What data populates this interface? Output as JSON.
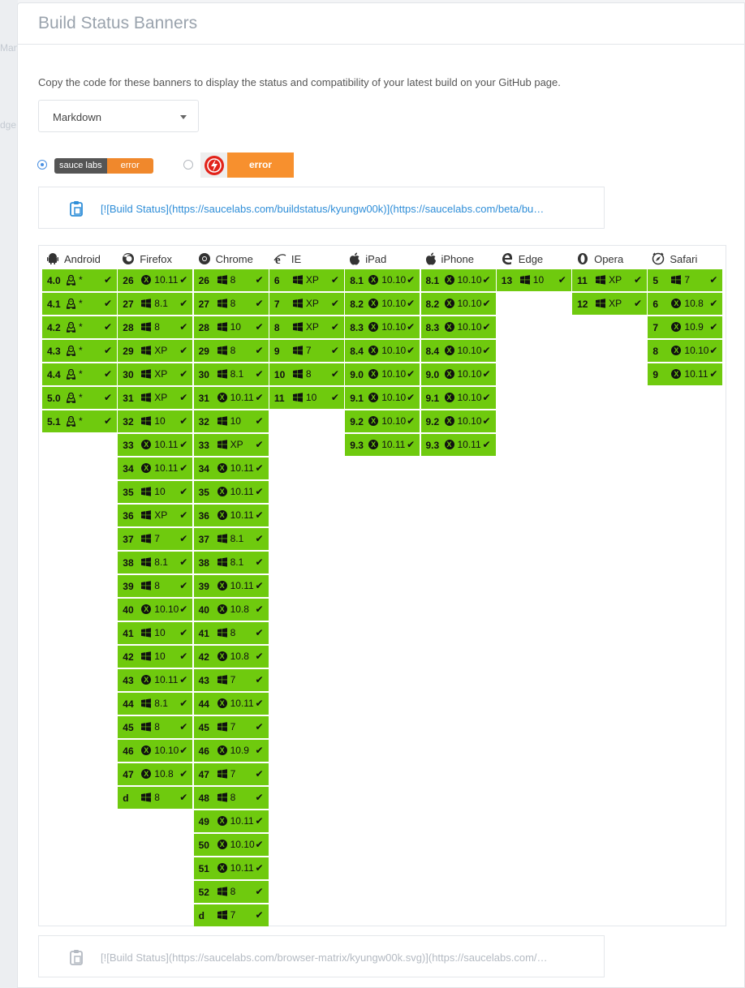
{
  "background": {
    "ghost_1": "Man",
    "ghost_2": "dge"
  },
  "title": "Build Status Banners",
  "description": "Copy the code for these banners to display the status and compatibility of your latest build on your GitHub page.",
  "format_select": {
    "value": "Markdown"
  },
  "badge_small": {
    "left": "sauce labs",
    "right": "error",
    "selected": true
  },
  "badge_large": {
    "right": "error",
    "selected": false
  },
  "code_1": "[![Build Status](https://saucelabs.com/buildstatus/kyungw00k)](https://saucelabs.com/beta/bu…",
  "code_2": "[![Build Status](https://saucelabs.com/browser-matrix/kyungw00k.svg)](https://saucelabs.com/…",
  "colors": {
    "pass": "#6fca0e",
    "badge_error": "#f0882c",
    "link": "#2f8ed8"
  },
  "matrix": {
    "columns": [
      {
        "name": "Android",
        "icon": "android-icon",
        "cells": [
          {
            "v": "4.0",
            "os": "linux",
            "osv": "*"
          },
          {
            "v": "4.1",
            "os": "linux",
            "osv": "*"
          },
          {
            "v": "4.2",
            "os": "linux",
            "osv": "*"
          },
          {
            "v": "4.3",
            "os": "linux",
            "osv": "*"
          },
          {
            "v": "4.4",
            "os": "linux",
            "osv": "*"
          },
          {
            "v": "5.0",
            "os": "linux",
            "osv": "*"
          },
          {
            "v": "5.1",
            "os": "linux",
            "osv": "*"
          }
        ]
      },
      {
        "name": "Firefox",
        "icon": "firefox-icon",
        "cells": [
          {
            "v": "26",
            "os": "mac",
            "osv": "10.11"
          },
          {
            "v": "27",
            "os": "win",
            "osv": "8.1"
          },
          {
            "v": "28",
            "os": "win",
            "osv": "8"
          },
          {
            "v": "29",
            "os": "win",
            "osv": "XP"
          },
          {
            "v": "30",
            "os": "win",
            "osv": "XP"
          },
          {
            "v": "31",
            "os": "win",
            "osv": "XP"
          },
          {
            "v": "32",
            "os": "win",
            "osv": "10"
          },
          {
            "v": "33",
            "os": "mac",
            "osv": "10.11"
          },
          {
            "v": "34",
            "os": "mac",
            "osv": "10.11"
          },
          {
            "v": "35",
            "os": "win",
            "osv": "10"
          },
          {
            "v": "36",
            "os": "win",
            "osv": "XP"
          },
          {
            "v": "37",
            "os": "win",
            "osv": "7"
          },
          {
            "v": "38",
            "os": "win",
            "osv": "8.1"
          },
          {
            "v": "39",
            "os": "win",
            "osv": "8"
          },
          {
            "v": "40",
            "os": "mac",
            "osv": "10.10"
          },
          {
            "v": "41",
            "os": "win",
            "osv": "10"
          },
          {
            "v": "42",
            "os": "win",
            "osv": "10"
          },
          {
            "v": "43",
            "os": "mac",
            "osv": "10.11"
          },
          {
            "v": "44",
            "os": "win",
            "osv": "8.1"
          },
          {
            "v": "45",
            "os": "win",
            "osv": "8"
          },
          {
            "v": "46",
            "os": "mac",
            "osv": "10.10"
          },
          {
            "v": "47",
            "os": "mac",
            "osv": "10.8"
          },
          {
            "v": "d",
            "os": "win",
            "osv": "8"
          }
        ]
      },
      {
        "name": "Chrome",
        "icon": "chrome-icon",
        "cells": [
          {
            "v": "26",
            "os": "win",
            "osv": "8"
          },
          {
            "v": "27",
            "os": "win",
            "osv": "8"
          },
          {
            "v": "28",
            "os": "win",
            "osv": "10"
          },
          {
            "v": "29",
            "os": "win",
            "osv": "8"
          },
          {
            "v": "30",
            "os": "win",
            "osv": "8.1"
          },
          {
            "v": "31",
            "os": "mac",
            "osv": "10.11"
          },
          {
            "v": "32",
            "os": "win",
            "osv": "10"
          },
          {
            "v": "33",
            "os": "win",
            "osv": "XP"
          },
          {
            "v": "34",
            "os": "mac",
            "osv": "10.11"
          },
          {
            "v": "35",
            "os": "mac",
            "osv": "10.11"
          },
          {
            "v": "36",
            "os": "mac",
            "osv": "10.11"
          },
          {
            "v": "37",
            "os": "win",
            "osv": "8.1"
          },
          {
            "v": "38",
            "os": "win",
            "osv": "8.1"
          },
          {
            "v": "39",
            "os": "mac",
            "osv": "10.11"
          },
          {
            "v": "40",
            "os": "mac",
            "osv": "10.8"
          },
          {
            "v": "41",
            "os": "win",
            "osv": "8"
          },
          {
            "v": "42",
            "os": "mac",
            "osv": "10.8"
          },
          {
            "v": "43",
            "os": "win",
            "osv": "7"
          },
          {
            "v": "44",
            "os": "mac",
            "osv": "10.11"
          },
          {
            "v": "45",
            "os": "win",
            "osv": "7"
          },
          {
            "v": "46",
            "os": "mac",
            "osv": "10.9"
          },
          {
            "v": "47",
            "os": "win",
            "osv": "7"
          },
          {
            "v": "48",
            "os": "win",
            "osv": "8"
          },
          {
            "v": "49",
            "os": "mac",
            "osv": "10.11"
          },
          {
            "v": "50",
            "os": "mac",
            "osv": "10.10"
          },
          {
            "v": "51",
            "os": "mac",
            "osv": "10.11"
          },
          {
            "v": "52",
            "os": "win",
            "osv": "8"
          },
          {
            "v": "d",
            "os": "win",
            "osv": "7"
          }
        ]
      },
      {
        "name": "IE",
        "icon": "ie-icon",
        "cells": [
          {
            "v": "6",
            "os": "win",
            "osv": "XP"
          },
          {
            "v": "7",
            "os": "win",
            "osv": "XP"
          },
          {
            "v": "8",
            "os": "win",
            "osv": "XP"
          },
          {
            "v": "9",
            "os": "win",
            "osv": "7"
          },
          {
            "v": "10",
            "os": "win",
            "osv": "8"
          },
          {
            "v": "11",
            "os": "win",
            "osv": "10"
          }
        ]
      },
      {
        "name": "iPad",
        "icon": "apple-icon",
        "cells": [
          {
            "v": "8.1",
            "os": "mac",
            "osv": "10.10"
          },
          {
            "v": "8.2",
            "os": "mac",
            "osv": "10.10"
          },
          {
            "v": "8.3",
            "os": "mac",
            "osv": "10.10"
          },
          {
            "v": "8.4",
            "os": "mac",
            "osv": "10.10"
          },
          {
            "v": "9.0",
            "os": "mac",
            "osv": "10.10"
          },
          {
            "v": "9.1",
            "os": "mac",
            "osv": "10.10"
          },
          {
            "v": "9.2",
            "os": "mac",
            "osv": "10.10"
          },
          {
            "v": "9.3",
            "os": "mac",
            "osv": "10.11"
          }
        ]
      },
      {
        "name": "iPhone",
        "icon": "apple-icon",
        "cells": [
          {
            "v": "8.1",
            "os": "mac",
            "osv": "10.10"
          },
          {
            "v": "8.2",
            "os": "mac",
            "osv": "10.10"
          },
          {
            "v": "8.3",
            "os": "mac",
            "osv": "10.10"
          },
          {
            "v": "8.4",
            "os": "mac",
            "osv": "10.10"
          },
          {
            "v": "9.0",
            "os": "mac",
            "osv": "10.10"
          },
          {
            "v": "9.1",
            "os": "mac",
            "osv": "10.10"
          },
          {
            "v": "9.2",
            "os": "mac",
            "osv": "10.10"
          },
          {
            "v": "9.3",
            "os": "mac",
            "osv": "10.11"
          }
        ]
      },
      {
        "name": "Edge",
        "icon": "edge-icon",
        "cells": [
          {
            "v": "13",
            "os": "win",
            "osv": "10"
          }
        ]
      },
      {
        "name": "Opera",
        "icon": "opera-icon",
        "cells": [
          {
            "v": "11",
            "os": "win",
            "osv": "XP"
          },
          {
            "v": "12",
            "os": "win",
            "osv": "XP"
          }
        ]
      },
      {
        "name": "Safari",
        "icon": "safari-icon",
        "cells": [
          {
            "v": "5",
            "os": "win",
            "osv": "7"
          },
          {
            "v": "6",
            "os": "mac",
            "osv": "10.8"
          },
          {
            "v": "7",
            "os": "mac",
            "osv": "10.9"
          },
          {
            "v": "8",
            "os": "mac",
            "osv": "10.10"
          },
          {
            "v": "9",
            "os": "mac",
            "osv": "10.11"
          }
        ]
      }
    ]
  }
}
